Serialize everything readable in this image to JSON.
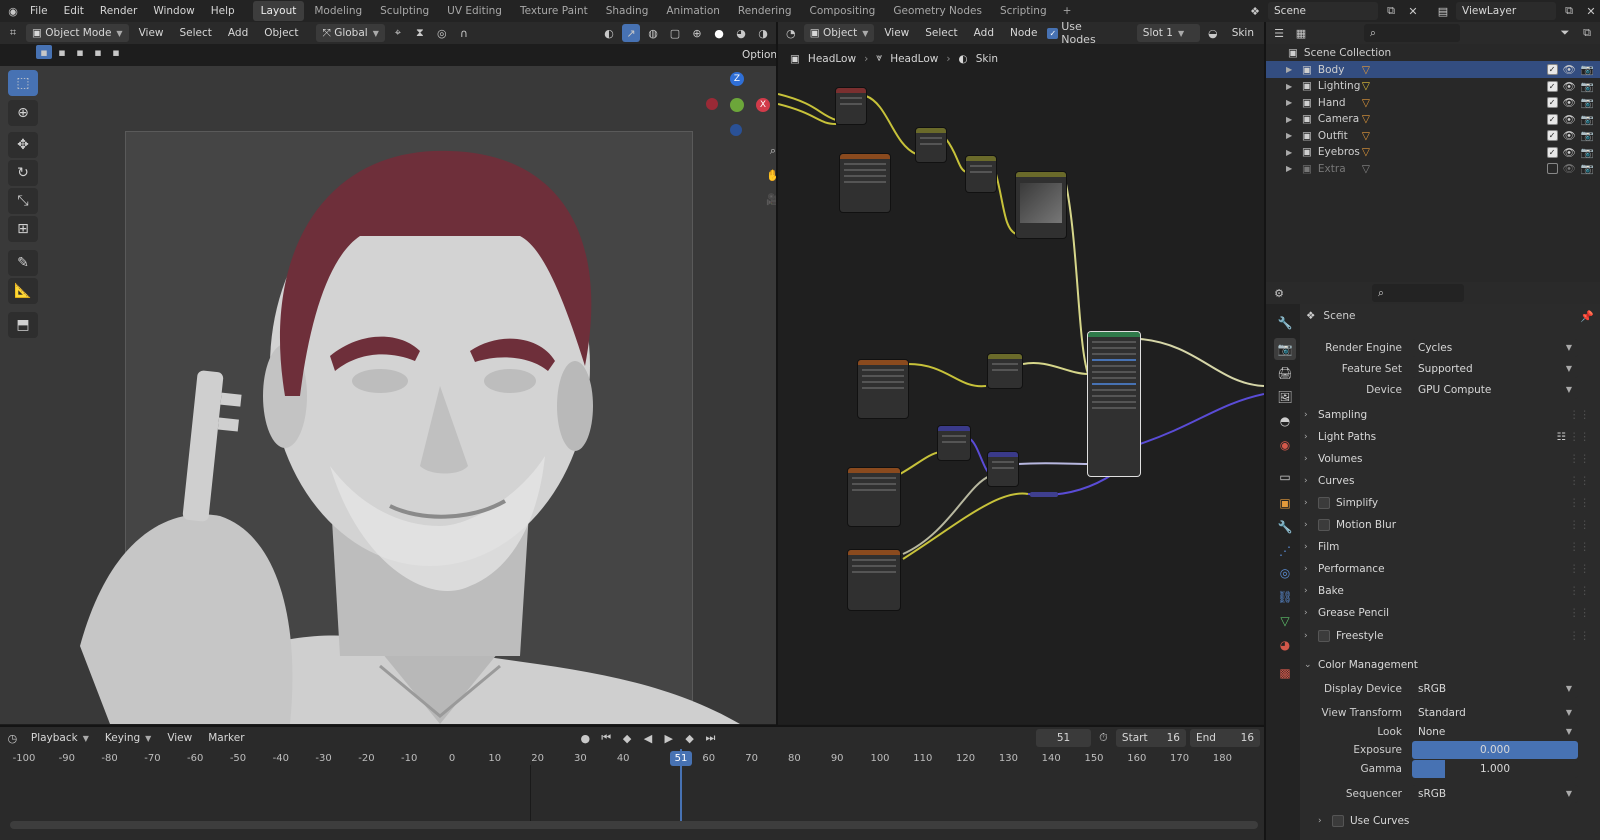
{
  "menu": [
    "File",
    "Edit",
    "Render",
    "Window",
    "Help"
  ],
  "workspaces": [
    {
      "label": "Layout",
      "active": true
    },
    {
      "label": "Modeling"
    },
    {
      "label": "Sculpting"
    },
    {
      "label": "UV Editing"
    },
    {
      "label": "Texture Paint"
    },
    {
      "label": "Shading"
    },
    {
      "label": "Animation"
    },
    {
      "label": "Rendering"
    },
    {
      "label": "Compositing"
    },
    {
      "label": "Geometry Nodes"
    },
    {
      "label": "Scripting"
    }
  ],
  "add_workspace": "+",
  "scene_name": "Scene",
  "view_layer": "ViewLayer",
  "viewport_header": {
    "mode": "Object Mode",
    "view": "View",
    "select": "Select",
    "add": "Add",
    "object": "Object",
    "transform": "Global",
    "options": "Options"
  },
  "node_header": {
    "type": "Object",
    "view": "View",
    "select": "Select",
    "add": "Add",
    "node": "Node",
    "use_nodes": "Use Nodes",
    "slot": "Slot 1",
    "material": "Skin"
  },
  "breadcrumb": [
    "HeadLow",
    "HeadLow",
    "Skin"
  ],
  "outliner": {
    "root": "Scene Collection",
    "items": [
      {
        "label": "Body",
        "selected": true,
        "checked": true
      },
      {
        "label": "Lighting",
        "checked": true
      },
      {
        "label": "Hand",
        "checked": true
      },
      {
        "label": "Camera",
        "checked": true
      },
      {
        "label": "Outfit",
        "checked": true
      },
      {
        "label": "Eyebros",
        "checked": true
      },
      {
        "label": "Extra",
        "checked": false,
        "dim": true
      }
    ]
  },
  "properties": {
    "context": "Scene",
    "render_engine_label": "Render Engine",
    "render_engine": "Cycles",
    "feature_set_label": "Feature Set",
    "feature_set": "Supported",
    "device_label": "Device",
    "device": "GPU Compute",
    "panels": [
      "Sampling",
      "Light Paths",
      "Volumes",
      "Curves",
      "Simplify",
      "Motion Blur",
      "Film",
      "Performance",
      "Bake",
      "Grease Pencil",
      "Freestyle"
    ],
    "panels_with_checkbox": [
      "Simplify",
      "Motion Blur",
      "Freestyle"
    ],
    "color_management": "Color Management",
    "display_device_label": "Display Device",
    "display_device": "sRGB",
    "view_transform_label": "View Transform",
    "view_transform": "Standard",
    "look_label": "Look",
    "look": "None",
    "exposure_label": "Exposure",
    "exposure": "0.000",
    "gamma_label": "Gamma",
    "gamma": "1.000",
    "gamma_fraction": 0.2,
    "sequencer_label": "Sequencer",
    "sequencer": "sRGB",
    "use_curves": "Use Curves"
  },
  "timeline": {
    "playback": "Playback",
    "keying": "Keying",
    "view": "View",
    "marker": "Marker",
    "current_frame": "51",
    "start_label": "Start",
    "start": "16",
    "end_label": "End",
    "end": "16",
    "ticks": [
      "-100",
      "-90",
      "-80",
      "-70",
      "-60",
      "-50",
      "-40",
      "-30",
      "-20",
      "-10",
      "0",
      "10",
      "20",
      "30",
      "40",
      "60",
      "70",
      "80",
      "90",
      "100",
      "110",
      "120",
      "130",
      "140",
      "150",
      "160",
      "170",
      "180"
    ],
    "playhead": "51"
  },
  "gizmo": {
    "z": "Z",
    "x": "X"
  },
  "colors": {
    "accent": "#4772b3",
    "header": "#2a2a2a",
    "panel": "#232323",
    "selected_row": "#334d80"
  }
}
